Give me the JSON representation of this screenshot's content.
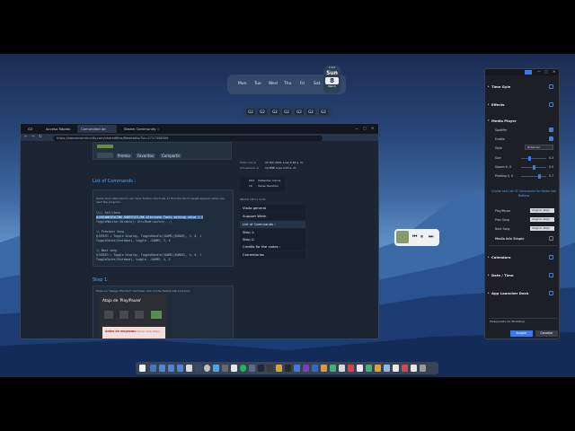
{
  "calendar": {
    "days": [
      "Mon",
      "Tue",
      "Wed",
      "Thu",
      "Fri",
      "Sat"
    ],
    "today_label": "Sun",
    "today_number": "8",
    "today_month": "March",
    "today_top": "2022"
  },
  "clock_strip": {
    "buttons": [
      "G2",
      "G2",
      "G2",
      "G2",
      "G2",
      "G2",
      "G2"
    ]
  },
  "browser": {
    "tabs": [
      {
        "label": "G2"
      },
      {
        "label": "Acceso Rápido"
      },
      {
        "label": "Comunidad de Steam :: Guía"
      },
      {
        "label": "Steam Community :: Gu..."
      }
    ],
    "url": "https://steamcommunity.com/sharedfiles/filedetails/?id=2727358399",
    "guide_buttons": [
      "Premio",
      "Favoritos",
      "Compartir"
    ],
    "list_heading": "List of Commands :",
    "list_text": "Guide from Alternate to use more Toolbar shortcuts, to find the tab to target appears when you start the program.",
    "code_lines": [
      "\\\\\\\\ Set\\\\Save",
      "@JXRSANESPACING SHORTCUTLINK Alternate Tools setting value 1 2",
      "ToggleMonitor(Disable): Alt+Mode:switch(...)",
      "\\\\ Previous Song",
      "@JXPATH + Toggle Display, ToggleHandle(SAOMS)(RANGE), 3, 0, 1",
      "ToggleCache(Shutdown), toggle...SAOMS, 3, 4",
      "\\\\ Next song",
      "@JXPATH + Toggle Display, ToggleHandle(SAOMS)(RANGE), 4, 0, 1",
      "ToggleCache(Shutdown), toggle...SAOMS, 4, 4"
    ],
    "step_heading": "Step 1:",
    "step_text": "Press on \"Assign Shortcut\" and then click on the Toolbar tab (not pin).",
    "dialog_title": "Atajo de 'Play/Pause'",
    "dialog_warning_title": "Antes de empezar:",
    "dialog_warning_text": "Mantener este atajo...",
    "sidebar_meta": [
      {
        "label": "Publicado el",
        "value": "20 DIC 2021 a las 4:18 a. m."
      },
      {
        "label": "Actualizado el",
        "value": "10 ENE a las 4:23 a. m."
      }
    ],
    "sidebar_stats": [
      {
        "label": "904",
        "value": "Visitantes únicos"
      },
      {
        "label": "10",
        "value": "Veces favoritos"
      }
    ],
    "sidebar_section": "ÍNDICE DE LA GUÍA",
    "sidebar_nav": [
      "Visita general",
      "Support Wirth",
      "List of Commands :",
      "Step 1:",
      "Step 2:",
      "Credits for the codes :",
      "Comentarios"
    ]
  },
  "settings": {
    "sections": [
      {
        "label": "Time Gyle",
        "checked": false
      },
      {
        "label": "Effects",
        "checked": false
      },
      {
        "label": "Media Player",
        "checked": false
      }
    ],
    "media_player_options": [
      {
        "label": "Spotifier",
        "checked": true
      },
      {
        "label": "Enable",
        "checked": true
      }
    ],
    "style_label": "Style",
    "style_value": "Rollender",
    "sliders": [
      {
        "label": "Size",
        "value": "0.3"
      },
      {
        "label": "Spawn X, X",
        "value": "0.5"
      },
      {
        "label": "Padding X, X",
        "value": "0.7"
      }
    ],
    "link_text": "(Guide And List Of Commands For Media Info Buttons",
    "shortcuts": [
      {
        "label": "Play/Pause",
        "button": "Asignar atajo"
      },
      {
        "label": "Prev Song",
        "button": "Asignar atajo"
      },
      {
        "label": "Next Song",
        "button": "Asignar atajo"
      }
    ],
    "more_sections": [
      {
        "label": "Media Info Simple"
      },
      {
        "label": "Calendars"
      },
      {
        "label": "Date / Time"
      },
      {
        "label": "App Launcher Dock"
      }
    ],
    "workshop_label": "Presupuesto de Workshop",
    "accept_label": "Aceptar",
    "cancel_label": "Cancelar"
  },
  "colors": {
    "accent": "#3d7be0",
    "panel_bg": "#1c1f26",
    "browser_bg": "#1b2533"
  }
}
